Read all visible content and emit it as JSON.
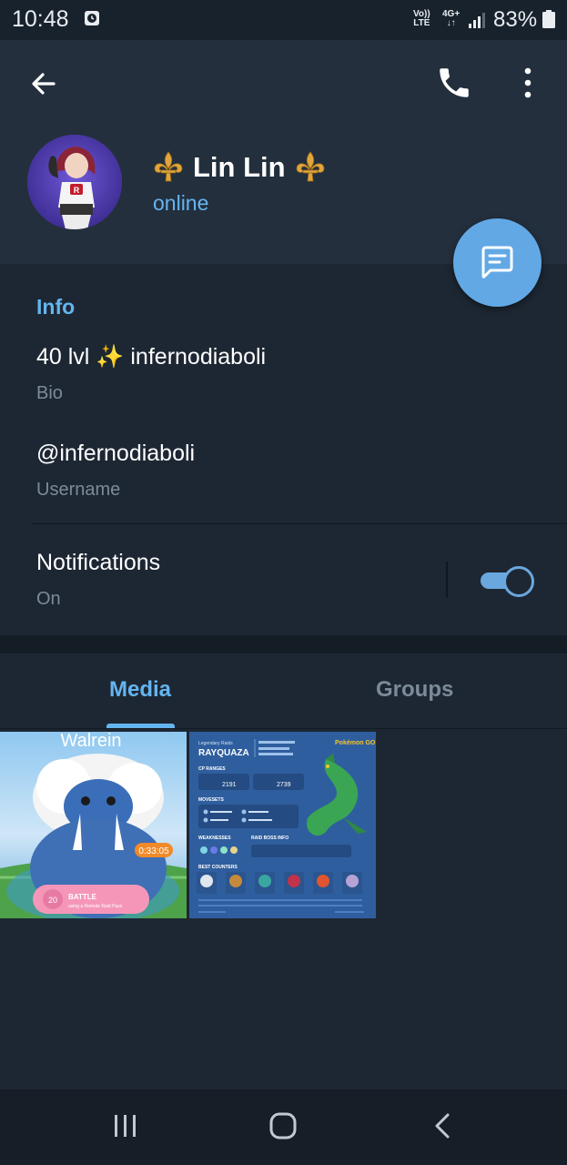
{
  "status_bar": {
    "time": "10:48",
    "volte_line1": "Vo))",
    "volte_line2": "LTE",
    "network_line1": "4G+",
    "network_line2": "↓↑",
    "battery": "83%"
  },
  "profile": {
    "name": "Lin Lin",
    "status": "online",
    "name_emoji": "fleur-de-lis-icon"
  },
  "info": {
    "section_title": "Info",
    "bio": "40 lvl ✨ infernodiaboli",
    "bio_label": "Bio",
    "username": "@infernodiaboli",
    "username_label": "Username",
    "notifications_title": "Notifications",
    "notifications_value": "On",
    "notifications_enabled": true
  },
  "tabs": [
    {
      "label": "Media",
      "active": true
    },
    {
      "label": "Groups",
      "active": false
    }
  ],
  "media": [
    {
      "title": "Walrein",
      "timer": "0:33:05",
      "battle_label": "BATTLE",
      "battle_sub": "using a Remote Raid Pass"
    },
    {
      "header_small": "Legendary Raids",
      "boss": "RAYQUAZA",
      "section_cp": "CP RANGES",
      "cp_1": "2191",
      "cp_2": "2739",
      "section_moves": "MOVESETS",
      "section_weak": "WEAKNESSES",
      "section_raid": "RAID BOSS INFO",
      "section_counters": "BEST COUNTERS",
      "logo": "Pokémon GO"
    }
  ],
  "colors": {
    "accent": "#64b5ef",
    "header_bg": "#232f3d",
    "page_bg": "#1d2733",
    "fab": "#62a8e5"
  }
}
